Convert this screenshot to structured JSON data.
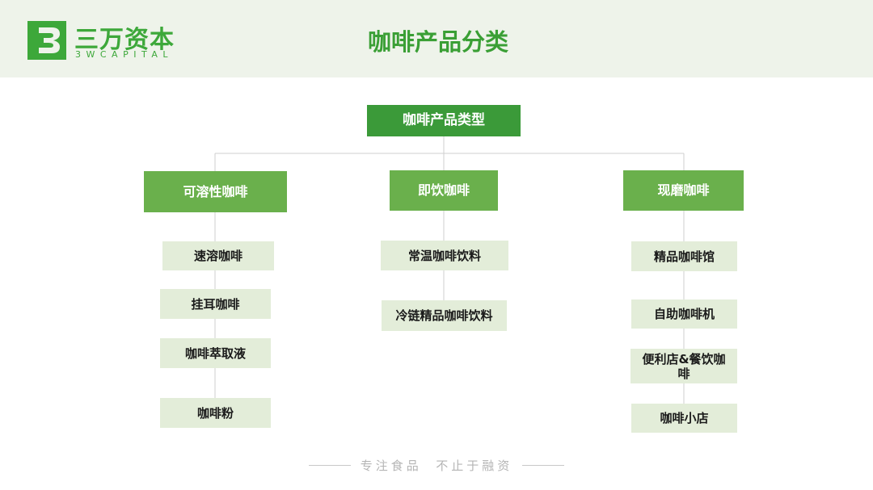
{
  "header": {
    "logo_cn": "三万资本",
    "logo_en": "3WCAPITAL",
    "title": "咖啡产品分类"
  },
  "tree": {
    "root": "咖啡产品类型",
    "categories": [
      {
        "label": "可溶性咖啡",
        "items": [
          "速溶咖啡",
          "挂耳咖啡",
          "咖啡萃取液",
          "咖啡粉"
        ]
      },
      {
        "label": "即饮咖啡",
        "items": [
          "常温咖啡饮料",
          "冷链精品咖啡饮料"
        ]
      },
      {
        "label": "现磨咖啡",
        "items": [
          "精品咖啡馆",
          "自助咖啡机",
          "便利店&餐饮咖啡",
          "咖啡小店"
        ]
      }
    ]
  },
  "footer": {
    "slogan": "专注食品  不止于融资"
  },
  "colors": {
    "brand_green": "#3da83a",
    "root_fill": "#3b9a39",
    "category_fill": "#6ab04c",
    "leaf_fill": "#e3edd9",
    "header_bg": "#eef3ea"
  }
}
